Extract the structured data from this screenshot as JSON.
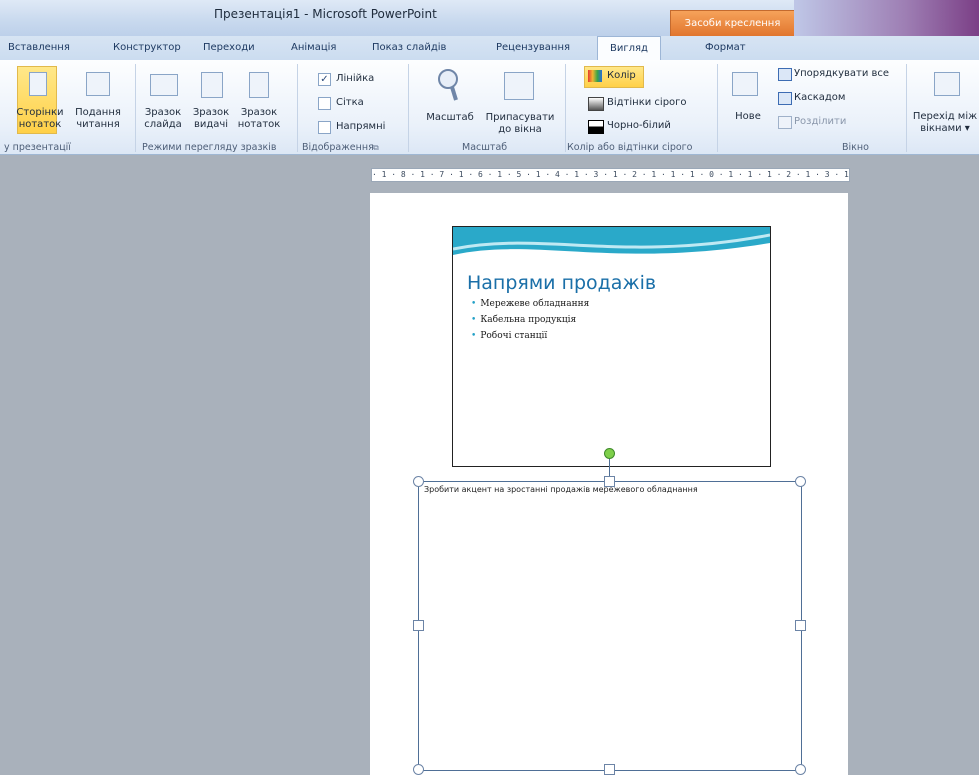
{
  "window": {
    "title": "Презентація1 - Microsoft PowerPoint",
    "context_tab": "Засоби креслення"
  },
  "tabs": [
    {
      "label": "Вставлення"
    },
    {
      "label": "Конструктор"
    },
    {
      "label": "Переходи"
    },
    {
      "label": "Анімація"
    },
    {
      "label": "Показ слайдів"
    },
    {
      "label": "Рецензування"
    },
    {
      "label": "Вигляд",
      "active": true
    },
    {
      "label": "Формат"
    }
  ],
  "ribbon": {
    "presentation_views": {
      "notes_page": [
        "Сторінки",
        "нотаток"
      ],
      "reading_view": [
        "Подання",
        "читання"
      ],
      "group_label": "у презентації"
    },
    "master_views": {
      "slide_master": [
        "Зразок",
        "слайда"
      ],
      "handout_master": [
        "Зразок",
        "видачі"
      ],
      "notes_master": [
        "Зразок",
        "нотаток"
      ],
      "group_label": "Режими перегляду зразків"
    },
    "show": {
      "ruler": "Лінійка",
      "gridlines": "Сітка",
      "guides": "Напрямні",
      "group_label": "Відображення"
    },
    "zoom": {
      "zoom": "Масштаб",
      "fit_window": [
        "Припасувати",
        "до вікна"
      ],
      "group_label": "Масштаб"
    },
    "color": {
      "color": "Колір",
      "grayscale": "Відтінки сірого",
      "bw": "Чорно-білий",
      "group_label": "Колір або відтінки сірого"
    },
    "window": {
      "new": "Нове",
      "arrange_all": "Упорядкувати все",
      "cascade": "Каскадом",
      "split": "Розділити",
      "group_label": "Вікно"
    },
    "switch": [
      "Перехід між",
      "вікнами ▾"
    ]
  },
  "ruler": {
    "text": "· 1 · 8 · 1 · 7 · 1 · 6 · 1 · 5 · 1 · 4 · 1 · 3 · 1 · 2 · 1 · 1 · 1 · 0 · 1 · 1 · 1 · 2 · 1 · 3 · 1 · 4 · 1 · 5 · 1 · 6 · 1 · 7 · 1 · 8 · 1 ·"
  },
  "slide": {
    "title": "Напрями продажів",
    "bullets": [
      "Мережеве обладнання",
      "Кабельна продукція",
      "Робочі станції"
    ]
  },
  "notes": {
    "text": "Зробити акцент на зростанні продажів мережевого обладнання"
  },
  "colors": {
    "accent": "#1a6fa8",
    "context_tab": "#e0742c",
    "bullet": "#23a1c7"
  }
}
